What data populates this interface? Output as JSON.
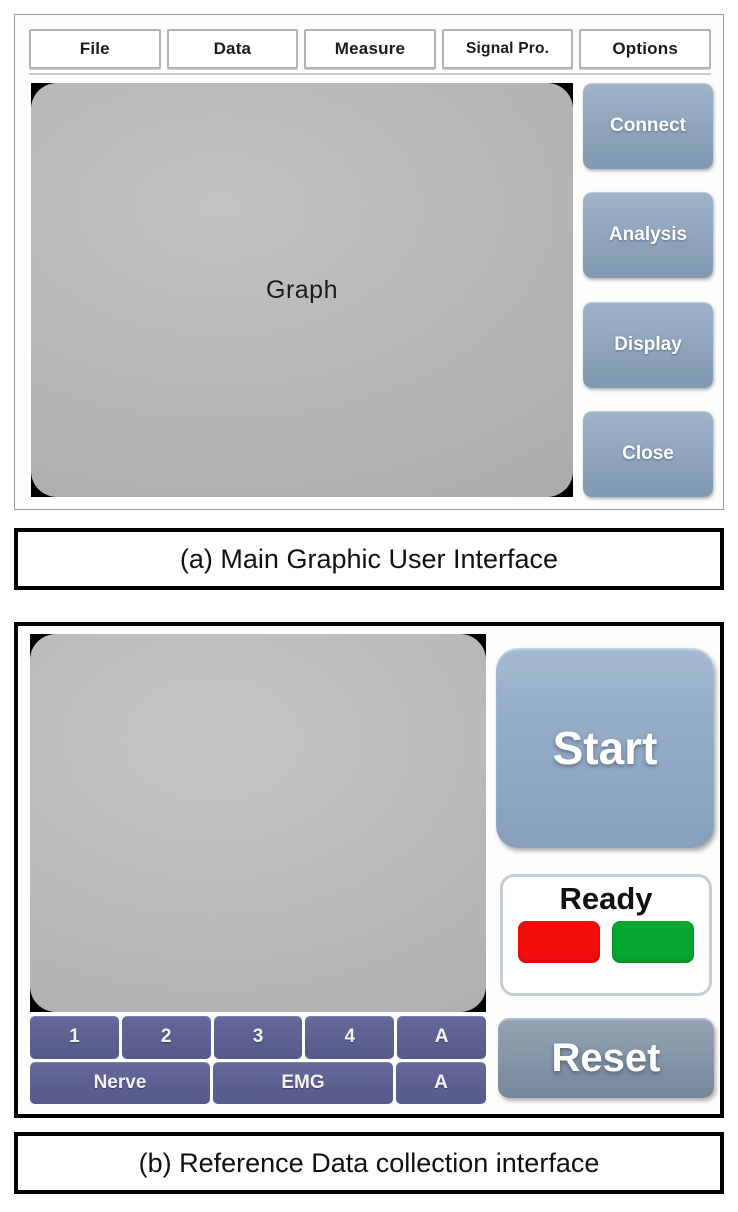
{
  "figure_a": {
    "menu": {
      "items": [
        {
          "label": "File",
          "name": "menu-file"
        },
        {
          "label": "Data",
          "name": "menu-data"
        },
        {
          "label": "Measure",
          "name": "menu-measure"
        },
        {
          "label": "Signal Pro.",
          "name": "menu-signal-pro"
        },
        {
          "label": "Options",
          "name": "menu-options"
        }
      ]
    },
    "graph": {
      "label": "Graph"
    },
    "side_buttons": [
      {
        "label": "Connect"
      },
      {
        "label": "Analysis"
      },
      {
        "label": "Display"
      },
      {
        "label": "Close"
      }
    ],
    "caption": "(a) Main Graphic User Interface"
  },
  "figure_b": {
    "graph": {
      "label": ""
    },
    "channel_table": {
      "row1": [
        "1",
        "2",
        "3",
        "4",
        "A"
      ],
      "row2": [
        "Nerve",
        "EMG",
        "A"
      ]
    },
    "start_button": {
      "label": "Start"
    },
    "ready_panel": {
      "label": "Ready",
      "indicators": [
        {
          "name": "red",
          "color": "#f20d0d"
        },
        {
          "name": "green",
          "color": "#07a72f"
        }
      ]
    },
    "reset_button": {
      "label": "Reset"
    },
    "caption": "(b) Reference Data collection interface"
  },
  "colors": {
    "button_blue": "#93a9c0",
    "start_blue": "#97aec8",
    "reset_gray": "#8798a9",
    "channel_slate": "#5b6091",
    "indicator_red": "#f20d0d",
    "indicator_green": "#07a72f",
    "graph_gray": "#b7b7b7"
  }
}
